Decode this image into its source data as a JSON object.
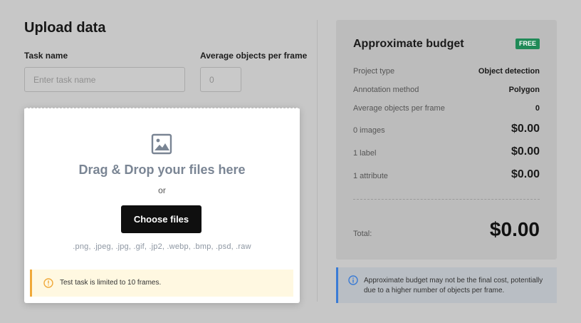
{
  "page": {
    "title": "Upload data"
  },
  "form": {
    "task_name_label": "Task name",
    "task_name_placeholder": "Enter task name",
    "task_name_value": "",
    "avg_objects_label": "Average objects per frame",
    "avg_objects_placeholder": "0",
    "avg_objects_value": ""
  },
  "dropzone": {
    "title": "Drag & Drop your files here",
    "or": "or",
    "button_label": "Choose files",
    "formats": ".png, .jpeg, .jpg, .gif, .jp2, .webp, .bmp, .psd, .raw",
    "icon": "image-icon",
    "warning_text": "Test task is limited to 10 frames.",
    "warning_icon": "warning-circle-icon",
    "warning_color": "#f0a93a"
  },
  "budget": {
    "title": "Approximate budget",
    "badge": "FREE",
    "badge_color": "#1f8a57",
    "rows": [
      {
        "label": "Project type",
        "value": "Object detection"
      },
      {
        "label": "Annotation method",
        "value": "Polygon"
      },
      {
        "label": "Average objects per frame",
        "value": "0"
      },
      {
        "label": "0 images",
        "value": "$0.00"
      },
      {
        "label": "1 label",
        "value": "$0.00"
      },
      {
        "label": "1 attribute",
        "value": "$0.00"
      }
    ],
    "total_label": "Total:",
    "total_value": "$0.00"
  },
  "info": {
    "text": "Approximate budget may not be the final cost, potentially due to a higher number of objects per frame.",
    "icon": "info-circle-icon",
    "accent_color": "#3a7bd5"
  }
}
